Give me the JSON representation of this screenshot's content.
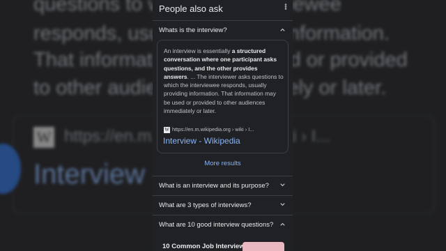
{
  "background": {
    "lines": [
      "questions to which the interviewee",
      "responds, usually providing information.",
      "That information may be used or provided",
      "to other audiences immediately or later."
    ],
    "url": "https://en.m.wikipedia.org › wiki › I...",
    "title": "Interview - Wikipedia",
    "logo_letter": "W"
  },
  "paa": {
    "header": "People also ask",
    "expanded": {
      "question": "Whats is the interview?",
      "answer_intro": "An interview is essentially ",
      "answer_bold": "a structured conversation where one participant asks questions, and the other provides answers",
      "answer_rest": ". ... The interviewer asks questions to which the interviewee responds, usually providing information. That information may be used or provided to other audiences immediately or later.",
      "source_url": "https://en.m.wikipedia.org › wiki › I...",
      "source_title": "Interview - Wikipedia",
      "source_icon_letter": "W"
    },
    "more_results": "More results",
    "questions": [
      "What is an interview and its purpose?",
      "What are 3 types of interviews?",
      "What are 10 good interview questions?"
    ],
    "bottom_card_title": "10 Common Job Interview"
  },
  "colors": {
    "background": "#202124",
    "link": "#8ab4f8",
    "text": "#e8eaed"
  }
}
